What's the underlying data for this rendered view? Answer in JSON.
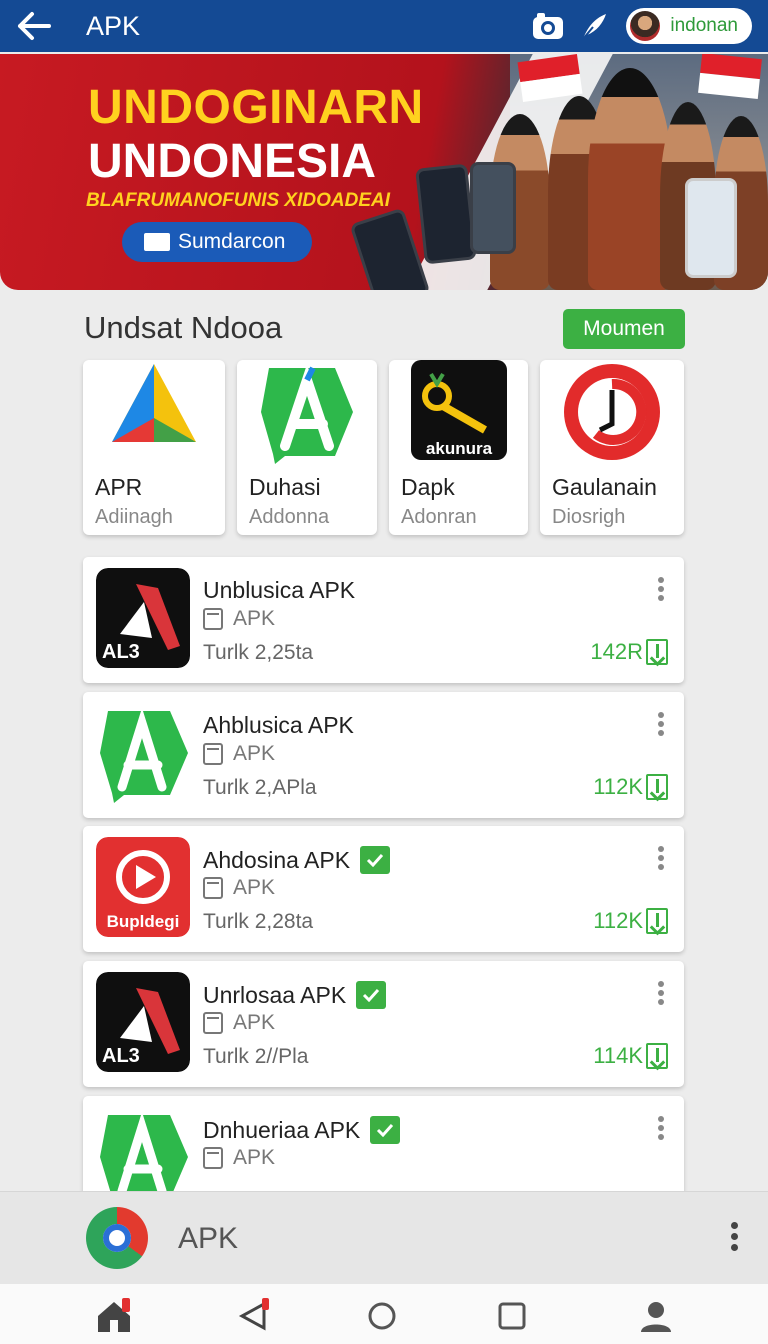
{
  "header": {
    "title": "APK",
    "profile_label": "indonan"
  },
  "banner": {
    "title_line1": "UNDOGINARN",
    "title_line2": "UNDONESIA",
    "subtitle": "BLAFRUMANOFUNIS XIDOADEAI",
    "button_label": "Sumdarcon"
  },
  "section": {
    "title": "Undsat Ndooa",
    "more_label": "Moumen"
  },
  "featured": [
    {
      "name": "APR",
      "sub": "Adiinagh"
    },
    {
      "name": "Duhasi",
      "sub": "Addonna"
    },
    {
      "name": "Dapk",
      "sub": "Adonran",
      "icon_text": "akunura"
    },
    {
      "name": "Gaulanain",
      "sub": "Diosrigh"
    }
  ],
  "apps": [
    {
      "title": "Unblusica APK",
      "type": "APK",
      "meta": "Turlk 2,25ta",
      "count": "142R",
      "verified": false,
      "icon_text": "AL3"
    },
    {
      "title": "Ahblusica APK",
      "type": "APK",
      "meta": "Turlk 2,APla",
      "count": "112K",
      "verified": false
    },
    {
      "title": "Ahdosina APK",
      "type": "APK",
      "meta": "Turlk 2,28ta",
      "count": "112K",
      "verified": true,
      "icon_text": "Bupldegi"
    },
    {
      "title": "Unrlosaa APK",
      "type": "APK",
      "meta": "Turlk 2//Pla",
      "count": "114K",
      "verified": true,
      "icon_text": "AL3"
    },
    {
      "title": "Dnhueriaa APK",
      "type": "APK",
      "verified": true
    }
  ],
  "player": {
    "label": "APK"
  },
  "colors": {
    "primary": "#144a94",
    "accent": "#3cb043",
    "banner_red": "#c71a22"
  }
}
